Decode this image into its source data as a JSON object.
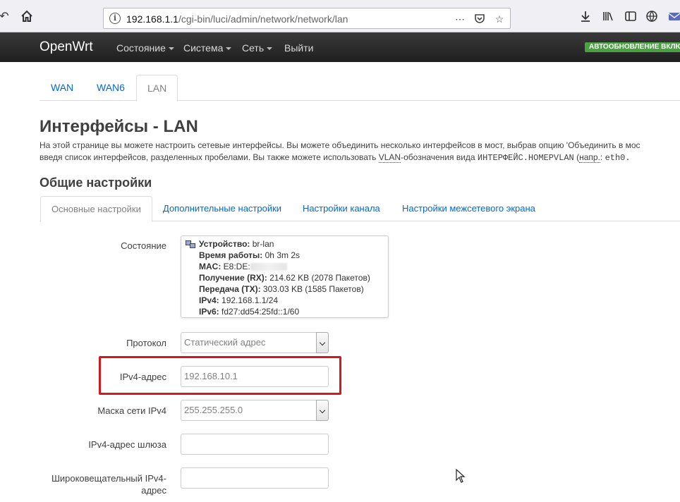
{
  "browser": {
    "url_host": "192.168.1.1",
    "url_path": "/cgi-bin/luci/admin/network/network/lan"
  },
  "nav": {
    "brand": "OpenWrt",
    "items": [
      "Состояние",
      "Система",
      "Сеть",
      "Выйти"
    ],
    "badge": "АВТООБНОВЛЕНИЕ ВКЛЮ"
  },
  "interface_tabs": [
    "WAN",
    "WAN6",
    "LAN"
  ],
  "page": {
    "title": "Интерфейсы - LAN",
    "desc_line1": "На этой странице вы можете настроить сетевые интерфейсы. Вы можете объединить несколько интерфейсов в мост, выбрав опцию 'Объединить в мос",
    "desc_line2_a": "введя список интерфейсов, разделенных пробелами. Вы также можете использовать ",
    "desc_vlan": "VLAN",
    "desc_line2_b": "-обозначения вида ",
    "desc_mono1": "ИНТЕРФЕЙС.НОМЕРVLAN",
    "desc_line2_c": " (",
    "desc_abbr": "напр.",
    "desc_line2_d": ": ",
    "desc_mono2": "eth0."
  },
  "section_title": "Общие настройки",
  "settings_tabs": [
    "Основные настройки",
    "Дополнительные настройки",
    "Настройки канала",
    "Настройки межсетевого экрана"
  ],
  "form": {
    "status_label": "Состояние",
    "status": {
      "device_k": "Устройство:",
      "device_v": " br-lan",
      "uptime_k": "Время работы:",
      "uptime_v": " 0h 3m 2s",
      "mac_k": "MAC:",
      "mac_v": " E8:DE:",
      "rx_k": "Получение (RX):",
      "rx_v": " 214.62 KB (2078 Пакетов)",
      "tx_k": "Передача (TX):",
      "tx_v": " 303.03 KB (1585 Пакетов)",
      "ipv4_k": "IPv4:",
      "ipv4_v": " 192.168.1.1/24",
      "ipv6_k": "IPv6:",
      "ipv6_v": " fd27:dd54:25fd::1/60"
    },
    "protocol_label": "Протокол",
    "protocol_value": "Статический адрес",
    "ipv4_label": "IPv4-адрес",
    "ipv4_value": "192.168.10.1",
    "mask_label": "Маска сети IPv4",
    "mask_value": "255.255.255.0",
    "gateway_label": "IPv4-адрес шлюза",
    "gateway_value": "",
    "broadcast_label_1": "Широковещательный IPv4-",
    "broadcast_label_2": "адрес",
    "broadcast_value": ""
  },
  "colors": {
    "link": "#0069d6",
    "highlight": "#d2191e",
    "badge": "#48a23f"
  }
}
